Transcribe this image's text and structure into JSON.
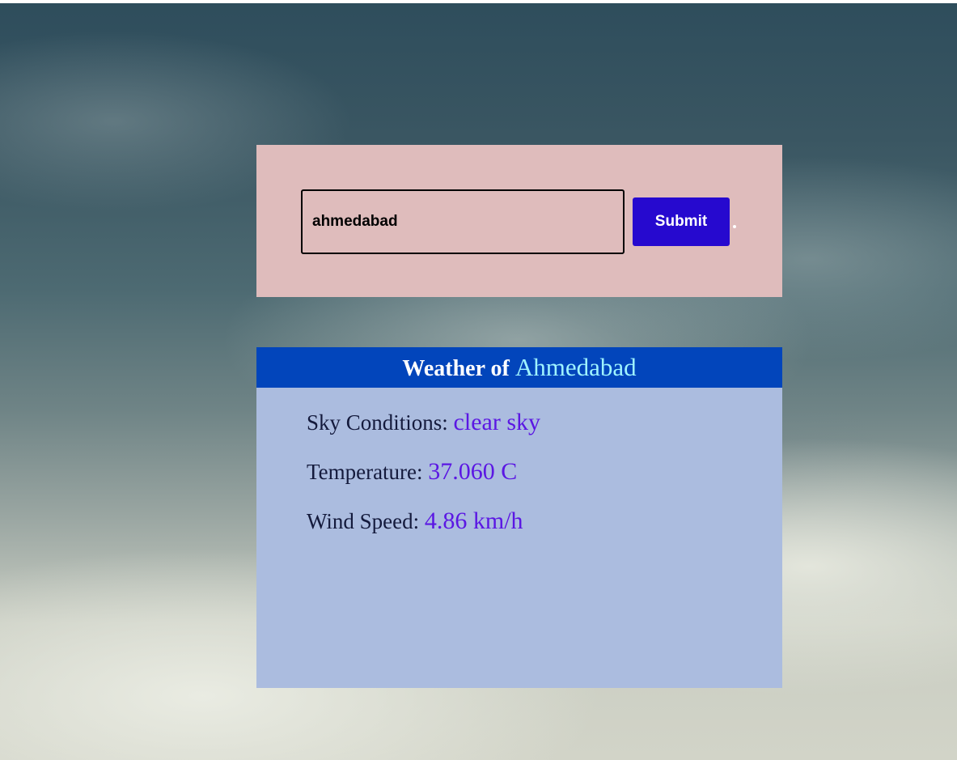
{
  "search": {
    "input_value": "ahmedabad",
    "submit_label": "Submit"
  },
  "result": {
    "heading_prefix": "Weather of",
    "city": "Ahmedabad",
    "sky_label": "Sky Conditions:",
    "sky_value": "clear sky",
    "temp_label": "Temperature:",
    "temp_value": "37.060 C",
    "wind_label": "Wind Speed:",
    "wind_value": "4.86 km/h"
  },
  "colors": {
    "search_panel_bg": "#dfbcbc",
    "submit_button_bg": "#2609cf",
    "result_header_bg": "#0245bb",
    "result_panel_bg": "#abbcdf",
    "city_name_color": "#9ff3ff",
    "value_color": "#5b17e3"
  }
}
